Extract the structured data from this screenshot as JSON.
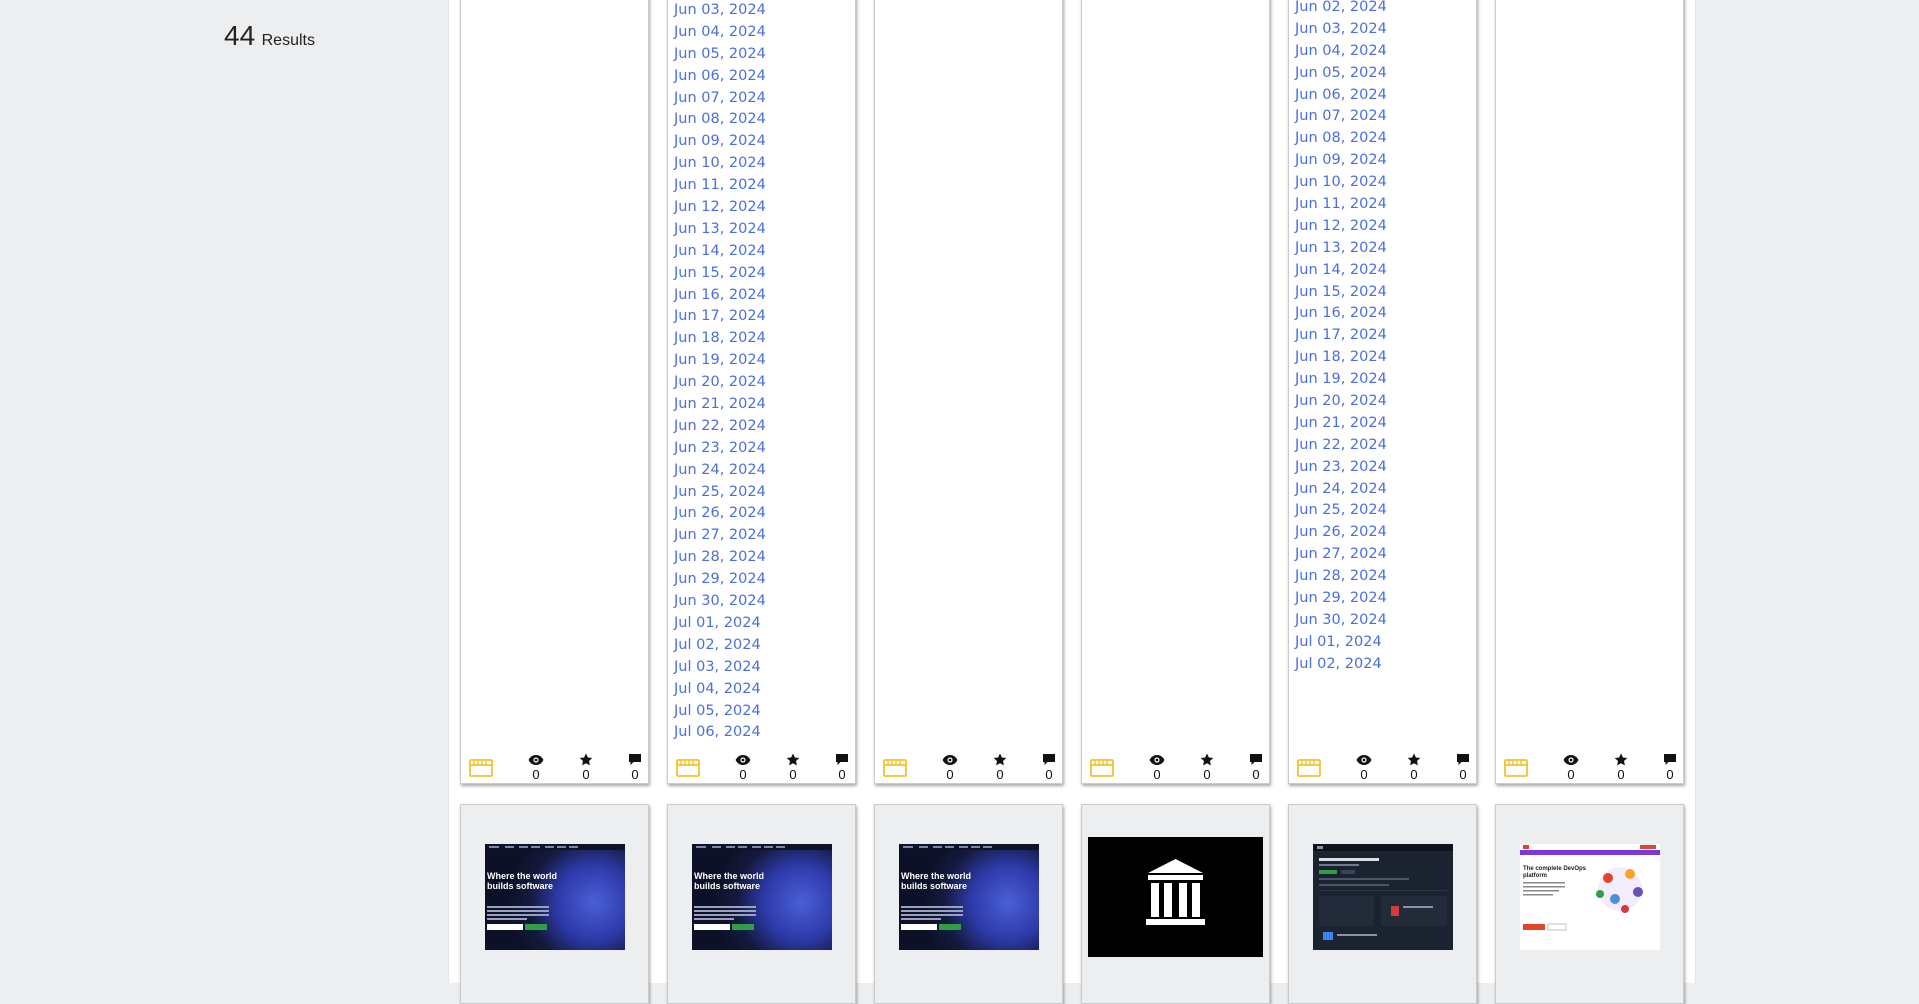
{
  "results": {
    "count": "44",
    "label": "Results"
  },
  "row1": {
    "cards": [
      {
        "dates": []
      },
      {
        "dates": [
          "Jun 03, 2024",
          "Jun 04, 2024",
          "Jun 05, 2024",
          "Jun 06, 2024",
          "Jun 07, 2024",
          "Jun 08, 2024",
          "Jun 09, 2024",
          "Jun 10, 2024",
          "Jun 11, 2024",
          "Jun 12, 2024",
          "Jun 13, 2024",
          "Jun 14, 2024",
          "Jun 15, 2024",
          "Jun 16, 2024",
          "Jun 17, 2024",
          "Jun 18, 2024",
          "Jun 19, 2024",
          "Jun 20, 2024",
          "Jun 21, 2024",
          "Jun 22, 2024",
          "Jun 23, 2024",
          "Jun 24, 2024",
          "Jun 25, 2024",
          "Jun 26, 2024",
          "Jun 27, 2024",
          "Jun 28, 2024",
          "Jun 29, 2024",
          "Jun 30, 2024",
          "Jul 01, 2024",
          "Jul 02, 2024",
          "Jul 03, 2024",
          "Jul 04, 2024",
          "Jul 05, 2024",
          "Jul 06, 2024"
        ]
      },
      {
        "dates": []
      },
      {
        "dates": []
      },
      {
        "dates": [
          "Jun 02, 2024",
          "Jun 03, 2024",
          "Jun 04, 2024",
          "Jun 05, 2024",
          "Jun 06, 2024",
          "Jun 07, 2024",
          "Jun 08, 2024",
          "Jun 09, 2024",
          "Jun 10, 2024",
          "Jun 11, 2024",
          "Jun 12, 2024",
          "Jun 13, 2024",
          "Jun 14, 2024",
          "Jun 15, 2024",
          "Jun 16, 2024",
          "Jun 17, 2024",
          "Jun 18, 2024",
          "Jun 19, 2024",
          "Jun 20, 2024",
          "Jun 21, 2024",
          "Jun 22, 2024",
          "Jun 23, 2024",
          "Jun 24, 2024",
          "Jun 25, 2024",
          "Jun 26, 2024",
          "Jun 27, 2024",
          "Jun 28, 2024",
          "Jun 29, 2024",
          "Jun 30, 2024",
          "Jul 01, 2024",
          "Jul 02, 2024"
        ]
      },
      {
        "dates": []
      }
    ],
    "stats": {
      "views": "0",
      "stars": "0",
      "comments": "0"
    }
  },
  "row2": {
    "thumbs": [
      {
        "kind": "github",
        "headline": "Where the world builds software"
      },
      {
        "kind": "github",
        "headline": "Where the world builds software"
      },
      {
        "kind": "github",
        "headline": "Where the world builds software"
      },
      {
        "kind": "museum"
      },
      {
        "kind": "dashboard"
      },
      {
        "kind": "devops",
        "headline": "The complete DevOps platform"
      }
    ]
  },
  "colors": {
    "link": "#4a6fdc",
    "collection_icon": "#f2c230",
    "page_bg": "#eceef0",
    "card_bg": "#ffffff"
  },
  "icons": {
    "collection": "collection-icon",
    "views": "eye-icon",
    "stars": "star-icon",
    "comments": "comment-icon"
  }
}
